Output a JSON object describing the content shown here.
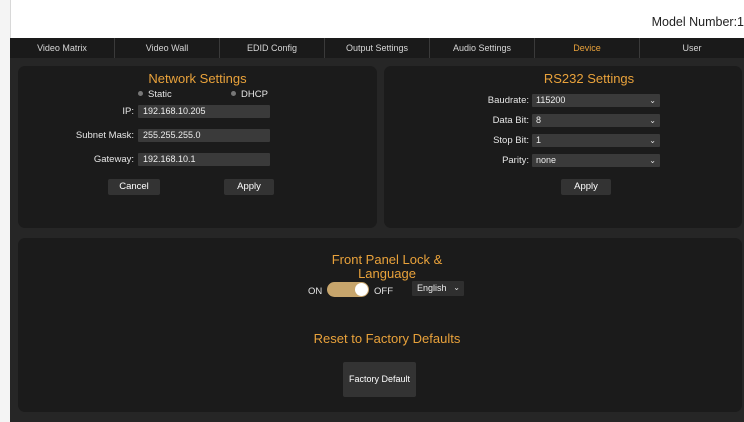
{
  "header": {
    "model_number": "Model Number:1"
  },
  "nav": {
    "tabs": [
      {
        "label": "Video Matrix"
      },
      {
        "label": "Video Wall"
      },
      {
        "label": "EDID Config"
      },
      {
        "label": "Output Settings"
      },
      {
        "label": "Audio Settings"
      },
      {
        "label": "Device",
        "active": true
      },
      {
        "label": "User"
      }
    ]
  },
  "network": {
    "title": "Network Settings",
    "static_label": "Static",
    "dhcp_label": "DHCP",
    "ip_label": "IP:",
    "ip_value": "192.168.10.205",
    "subnet_label": "Subnet Mask:",
    "subnet_value": "255.255.255.0",
    "gateway_label": "Gateway:",
    "gateway_value": "192.168.10.1",
    "cancel_label": "Cancel",
    "apply_label": "Apply"
  },
  "rs232": {
    "title": "RS232 Settings",
    "baudrate_label": "Baudrate:",
    "baudrate_value": "115200",
    "databit_label": "Data Bit:",
    "databit_value": "8",
    "stopbit_label": "Stop Bit:",
    "stopbit_value": "1",
    "parity_label": "Parity:",
    "parity_value": "none",
    "apply_label": "Apply"
  },
  "front_panel": {
    "title_line1": "Front Panel Lock &",
    "title_line2": "Language",
    "on_label": "ON",
    "off_label": "OFF",
    "language_value": "English"
  },
  "factory": {
    "title": "Reset to Factory Defaults",
    "button_label": "Factory Default"
  },
  "colors": {
    "accent": "#e9a23b",
    "panel_bg": "#1b1b1b",
    "toggle_color": "#c7a56c"
  },
  "icons": {
    "select_caret": "chevron-down-icon"
  }
}
